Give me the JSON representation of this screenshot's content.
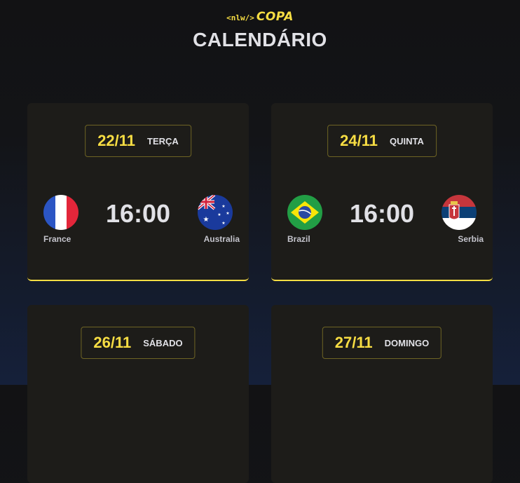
{
  "header": {
    "logo_code": "<nlw/>",
    "logo_word": "COPA",
    "title": "CALENDÁRIO"
  },
  "colors": {
    "accent": "#F7DD43",
    "card_bg": "#1d1c19",
    "text": "#E1E1E6"
  },
  "matches": [
    {
      "date": "22/11",
      "weekday": "TERÇA",
      "time": "16:00",
      "home": {
        "name": "France",
        "flag": "france-flag-icon"
      },
      "away": {
        "name": "Australia",
        "flag": "australia-flag-icon"
      }
    },
    {
      "date": "24/11",
      "weekday": "QUINTA",
      "time": "16:00",
      "home": {
        "name": "Brazil",
        "flag": "brazil-flag-icon"
      },
      "away": {
        "name": "Serbia",
        "flag": "serbia-flag-icon"
      }
    },
    {
      "date": "26/11",
      "weekday": "SÁBADO"
    },
    {
      "date": "27/11",
      "weekday": "DOMINGO"
    }
  ]
}
